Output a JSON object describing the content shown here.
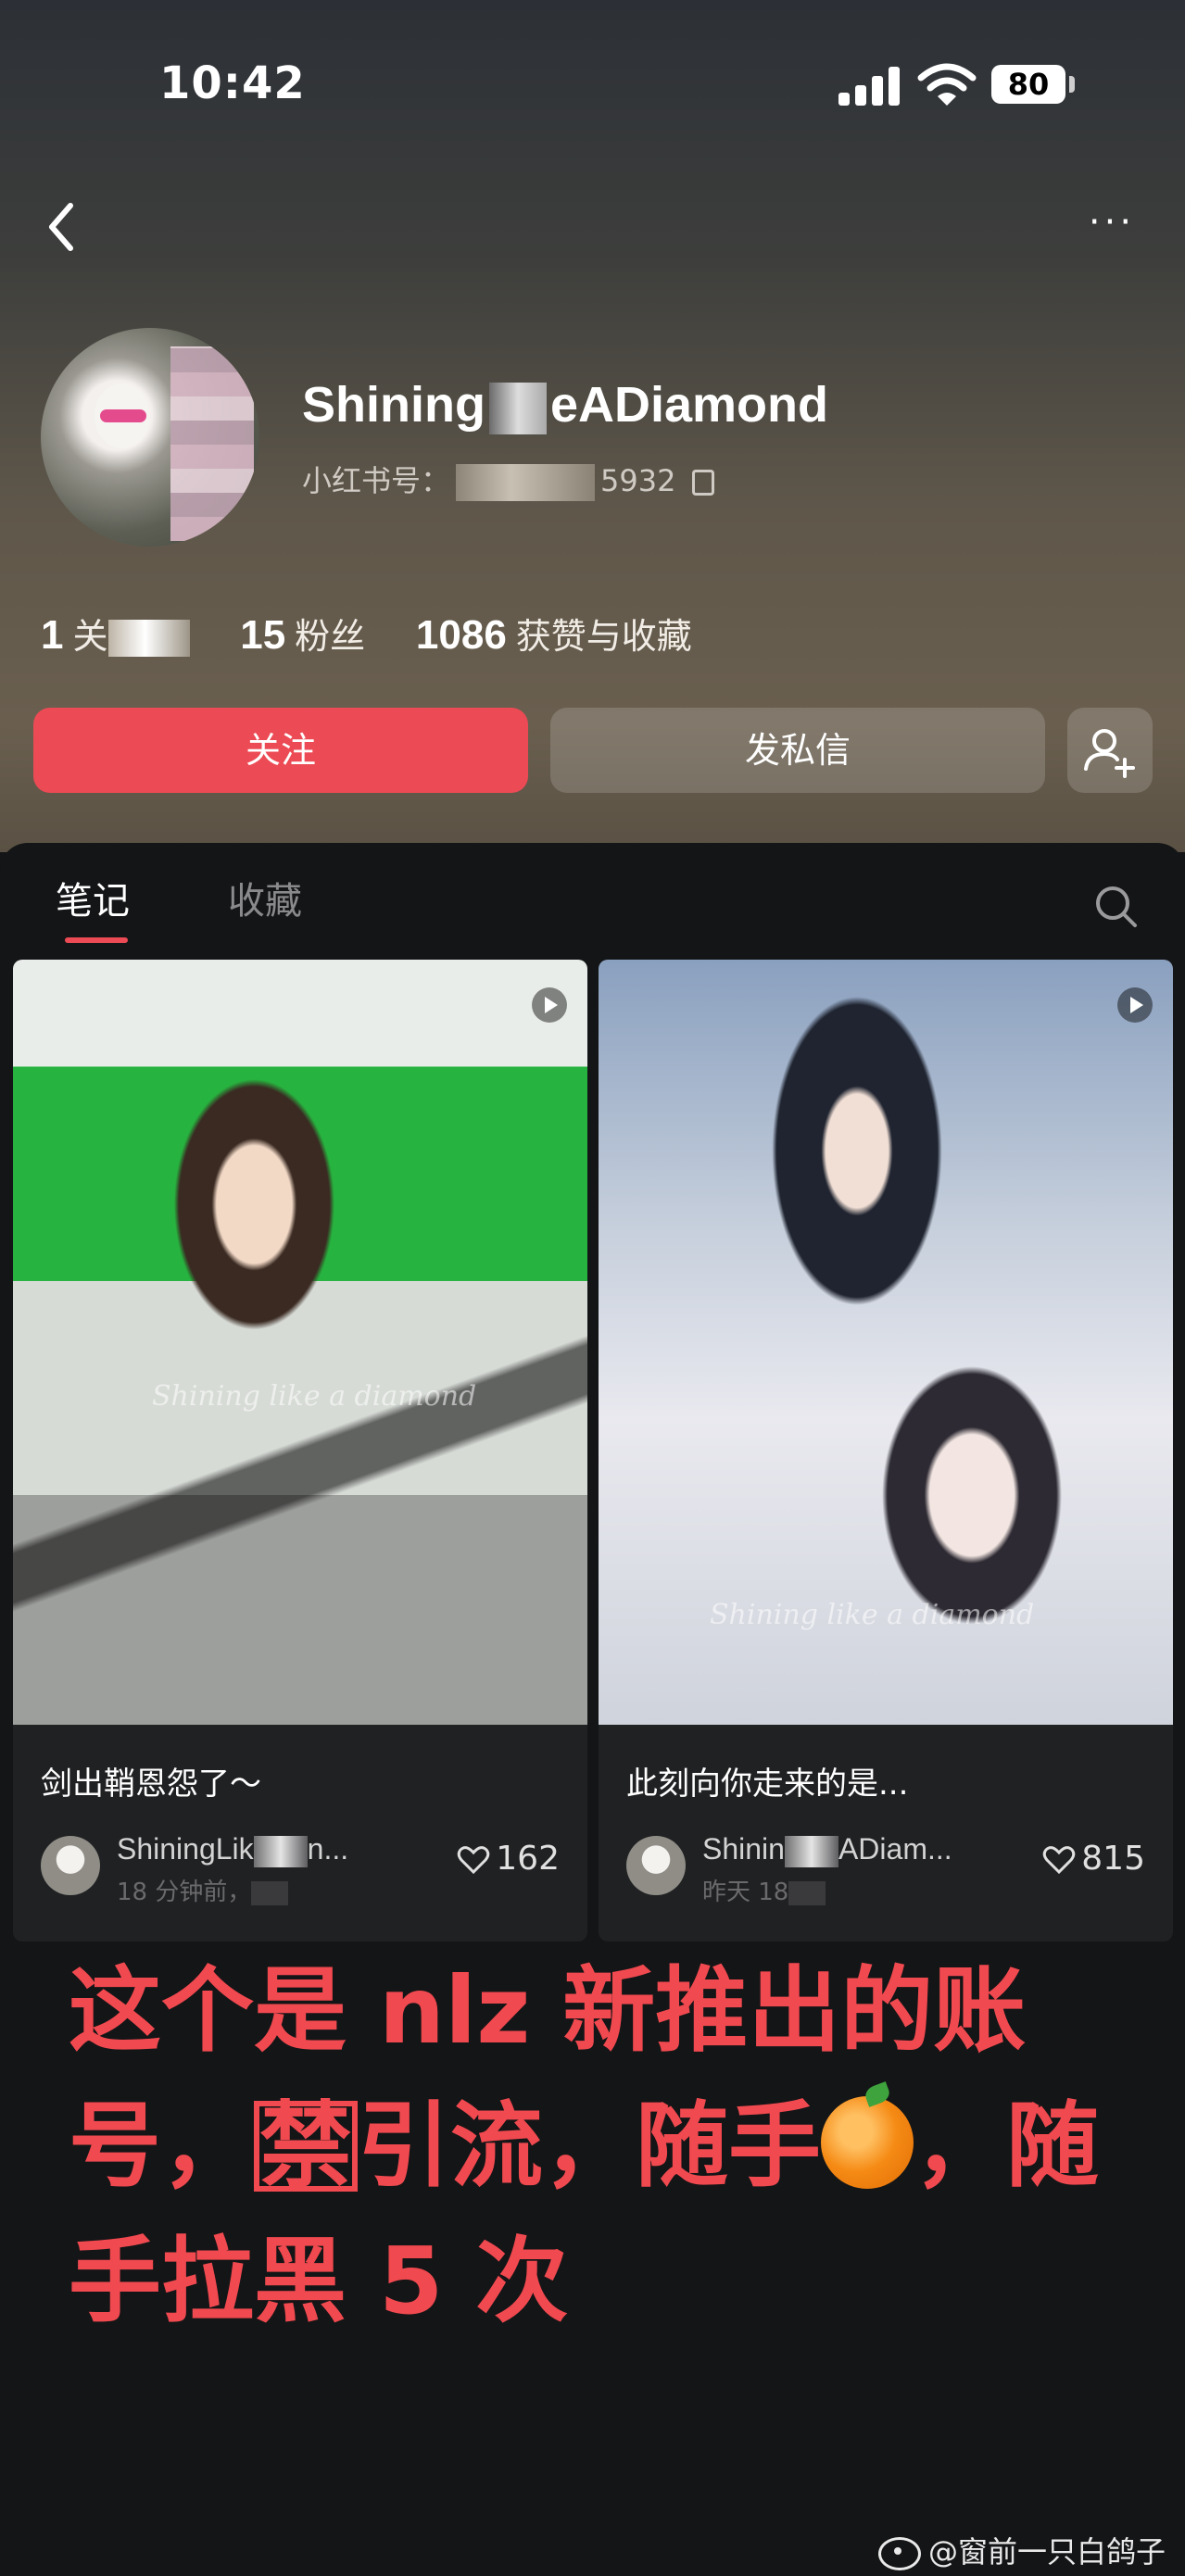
{
  "status_bar": {
    "time": "10:42",
    "battery": "80"
  },
  "profile": {
    "username_start": "Shining",
    "username_end": "eADiamond",
    "id_label": "小红书号：",
    "id_suffix": "5932",
    "stats": [
      {
        "value": "1",
        "label": "关"
      },
      {
        "value": "15",
        "label": "粉丝"
      },
      {
        "value": "1086",
        "label": "获赞与收藏"
      }
    ],
    "follow_label": "关注",
    "message_label": "发私信"
  },
  "tabs": {
    "notes": "笔记",
    "collections": "收藏"
  },
  "cards": [
    {
      "title": "剑出鞘恩怨了～",
      "author_start": "ShiningLik",
      "author_end": "n...",
      "time_ago": "18 分钟前，",
      "likes": "162",
      "watermark": "Shining like a diamond"
    },
    {
      "title": "此刻向你走来的是...",
      "author_start": "Shinin",
      "author_end": "ADiam...",
      "time_ago": "昨天 18",
      "likes": "815",
      "watermark": "Shining like a diamond"
    }
  ],
  "caption": {
    "line1": "这个是 nlz 新推出的账",
    "line2_pre": "号，",
    "line2_ban": "禁",
    "line2_mid": "引流，随手",
    "line2_post": "，随",
    "line3": "手拉黑 5 次"
  },
  "watermark_credit": "@窗前一只白鸽子",
  "colors": {
    "accent": "#ec4a54",
    "caption": "#f0494f"
  }
}
